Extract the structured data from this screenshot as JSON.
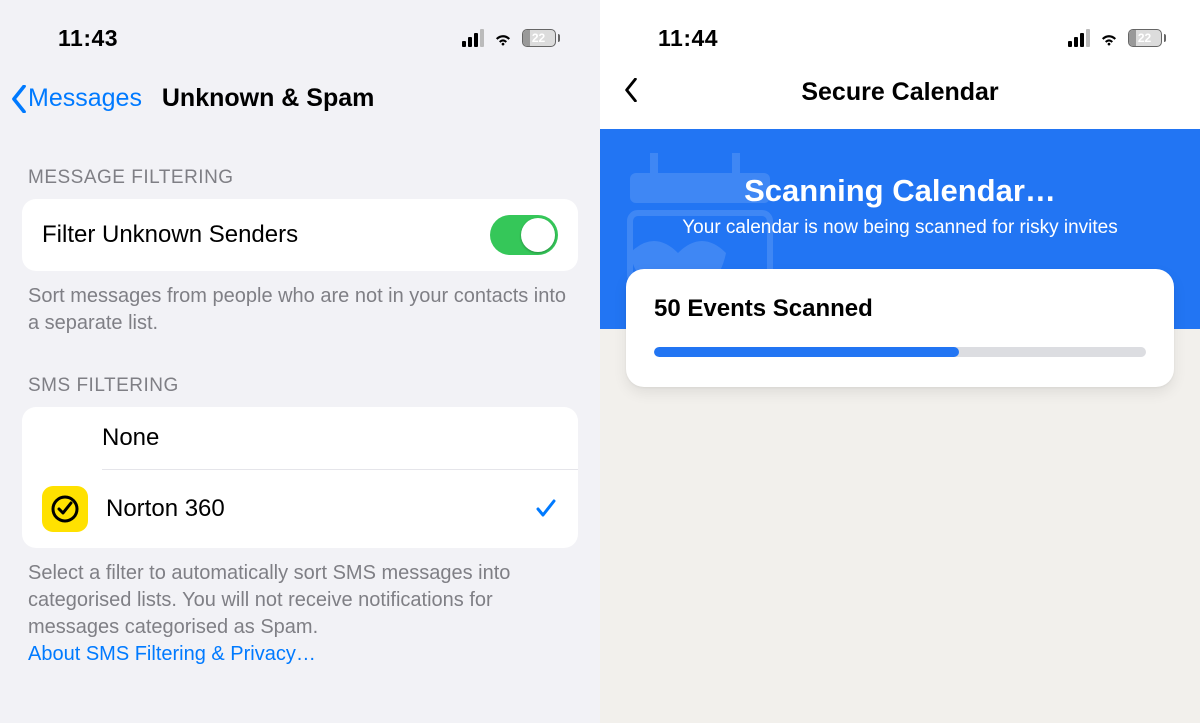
{
  "left": {
    "status": {
      "time": "11:43",
      "battery_pct": "22",
      "battery_fill": "22%"
    },
    "nav": {
      "back": "Messages",
      "title": "Unknown & Spam"
    },
    "sections": {
      "msg_filtering": {
        "head": "MESSAGE FILTERING",
        "row_label": "Filter Unknown Senders",
        "toggle_on": true,
        "help": "Sort messages from people who are not in your contacts into a separate list."
      },
      "sms_filtering": {
        "head": "SMS FILTERING",
        "options": [
          {
            "label": "None",
            "selected": false
          },
          {
            "label": "Norton 360",
            "selected": true,
            "icon": "norton-icon"
          }
        ],
        "help": "Select a filter to automatically sort SMS messages into categorised lists. You will not receive notifications for messages categorised as Spam.",
        "help_link": "About SMS Filtering & Privacy…"
      }
    }
  },
  "right": {
    "status": {
      "time": "11:44",
      "battery_pct": "22",
      "battery_fill": "22%"
    },
    "nav": {
      "title": "Secure Calendar"
    },
    "hero": {
      "title": "Scanning Calendar…",
      "subtitle": "Your calendar is now being scanned for risky invites"
    },
    "scan": {
      "title": "50 Events Scanned",
      "progress_pct": "62%"
    }
  },
  "colors": {
    "ios_blue": "#007aff",
    "toggle_green": "#35c759",
    "norton_blue": "#2275f3"
  }
}
